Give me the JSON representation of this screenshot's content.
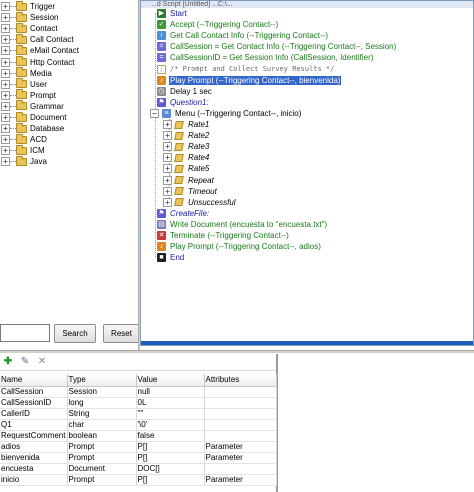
{
  "palette": {
    "items": [
      {
        "label": "Trigger",
        "expander": "+"
      },
      {
        "label": "Session",
        "expander": "+"
      },
      {
        "label": "Contact",
        "expander": "+"
      },
      {
        "label": "Call Contact",
        "expander": "+"
      },
      {
        "label": "eMail Contact",
        "expander": "+"
      },
      {
        "label": "Http Contact",
        "expander": "+"
      },
      {
        "label": "Media",
        "expander": "+"
      },
      {
        "label": "User",
        "expander": "+"
      },
      {
        "label": "Prompt",
        "expander": "+"
      },
      {
        "label": "Grammar",
        "expander": "+"
      },
      {
        "label": "Document",
        "expander": "+"
      },
      {
        "label": "Database",
        "expander": "+"
      },
      {
        "label": "ACD",
        "expander": "+"
      },
      {
        "label": "ICM",
        "expander": "+"
      },
      {
        "label": "Java",
        "expander": "+"
      }
    ],
    "search_value": "",
    "search_label": "Search",
    "reset_label": "Reset"
  },
  "script": {
    "title_fragment": "...d Script [Untitled] ...C:\\...",
    "steps": [
      {
        "text": "Start",
        "cls": "blue",
        "icon": "start-icon"
      },
      {
        "text": "Accept (--Triggering Contact--)",
        "cls": "green",
        "icon": "accept-icon"
      },
      {
        "text": "Get Call Contact Info (--Triggering Contact--)",
        "cls": "green",
        "icon": "get-info-icon"
      },
      {
        "text": "CallSession = Get Contact Info (--Triggering Contact--, Session)",
        "cls": "mixed",
        "icon": "set-icon"
      },
      {
        "text": "CallSessionID = Get Session Info (CallSession, Identifier)",
        "cls": "mixed",
        "icon": "set-icon"
      },
      {
        "text": "/* Prompt and Collect Survey Results */",
        "cls": "comment",
        "icon": "comment-icon"
      },
      {
        "text": "Play Prompt (--Triggering Contact--, bienvenida)",
        "cls": "selected",
        "icon": "play-prompt-icon"
      },
      {
        "text": "Delay 1 sec",
        "cls": "plain",
        "icon": "delay-icon"
      },
      {
        "text": "Question1:",
        "cls": "blue italic",
        "icon": "label-icon"
      },
      {
        "text": "Menu (--Triggering Contact--, inicio)",
        "cls": "plain",
        "icon": "menu-icon"
      },
      {
        "text": "Rate1",
        "cls": "italic",
        "icon": "rate-icon"
      },
      {
        "text": "Rate2",
        "cls": "italic",
        "icon": "rate-icon"
      },
      {
        "text": "Rate3",
        "cls": "italic",
        "icon": "rate-icon"
      },
      {
        "text": "Rate4",
        "cls": "italic",
        "icon": "rate-icon"
      },
      {
        "text": "Rate5",
        "cls": "italic",
        "icon": "rate-icon"
      },
      {
        "text": "Repeat",
        "cls": "italic",
        "icon": "rate-icon"
      },
      {
        "text": "Timeout",
        "cls": "italic",
        "icon": "rate-icon"
      },
      {
        "text": "Unsuccessful",
        "cls": "italic",
        "icon": "rate-icon"
      },
      {
        "text": "CreateFile:",
        "cls": "blue italic",
        "icon": "label-icon"
      },
      {
        "text": "Write Document (encuesta to \"encuesta.txt\")",
        "cls": "mixed2",
        "icon": "write-doc-icon"
      },
      {
        "text": "Terminate (--Triggering Contact--)",
        "cls": "mixed2",
        "icon": "terminate-icon"
      },
      {
        "text": "Play Prompt (--Triggering Contact--, adios)",
        "cls": "mixed2",
        "icon": "play-prompt-icon"
      },
      {
        "text": "End",
        "cls": "blue",
        "icon": "end-icon"
      }
    ]
  },
  "variables": {
    "columns": [
      "Name",
      "Type",
      "Value",
      "Attributes"
    ],
    "rows": [
      [
        "CallSession",
        "Session",
        "null",
        ""
      ],
      [
        "CallSessionID",
        "long",
        "0L",
        ""
      ],
      [
        "CallerID",
        "String",
        "\"\"",
        ""
      ],
      [
        "Q1",
        "char",
        "'\\0'",
        ""
      ],
      [
        "RequestComment",
        "boolean",
        "false",
        ""
      ],
      [
        "adios",
        "Prompt",
        "P[]",
        "Parameter"
      ],
      [
        "bienvenida",
        "Prompt",
        "P[]",
        "Parameter"
      ],
      [
        "encuesta",
        "Document",
        "DOC[]",
        ""
      ],
      [
        "inicio",
        "Prompt",
        "P[]",
        "Parameter"
      ]
    ]
  },
  "colors": {
    "selection": "#3366cc",
    "keyword_green": "#1a7a1a",
    "keyword_blue": "#1a1aa8"
  }
}
